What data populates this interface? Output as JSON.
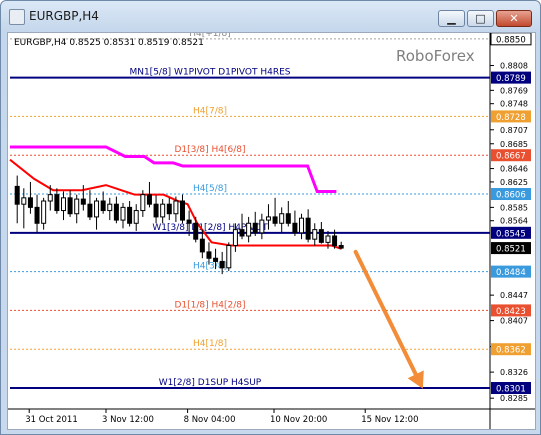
{
  "window": {
    "title": "EURGBP,H4",
    "min_glyph": "▁",
    "max_glyph": "□",
    "close_glyph": "✕"
  },
  "chart_data": {
    "type": "candlestick",
    "symbol_info": "EURGBP,H4  0.8525 0.8531 0.8519 0.8521",
    "watermark": "RoboForex",
    "ylim": [
      0.8268,
      0.8856
    ],
    "price_labels": [
      "0.8850",
      "0.8789",
      "0.8728",
      "0.8667",
      "0.8606",
      "0.8545",
      "0.8484",
      "0.8423",
      "0.8362",
      "0.8301"
    ],
    "tick_labels": [
      "0.8850",
      "0.8789",
      "0.8728",
      "0.8667",
      "0.8606",
      "0.8545",
      "0.8521",
      "0.8484",
      "0.8423",
      "0.8362",
      "0.8301",
      "0.8285",
      "0.8326",
      "0.8366",
      "0.8407",
      "0.8447",
      "0.8564",
      "0.8585",
      "0.8625",
      "0.8646",
      "0.8685",
      "0.8707",
      "0.8748",
      "0.8769",
      "0.8808"
    ],
    "x_labels": [
      "31 Oct 2011",
      "3 Nov 12:00",
      "8 Nov 04:00",
      "10 Nov 20:00",
      "15 Nov 12:00"
    ],
    "x_domain": [
      0,
      100
    ],
    "x_label_positions": [
      4,
      20,
      37,
      55,
      74
    ],
    "current_price": "0.8521",
    "levels": [
      {
        "price": 0.885,
        "label": "H4[+1/8]",
        "color": "#a0a0a0",
        "style": "dash",
        "tag_bg": "#ffffff",
        "tag_fg": "#000000",
        "tag": "0.8850"
      },
      {
        "price": 0.8789,
        "label": "MN1[5/8]  W1PIVOT  D1PIVOT  H4RES",
        "color": "#00007f",
        "style": "solid",
        "tag_bg": "#00007f",
        "tag_fg": "#ffffff",
        "tag": "0.8789",
        "label_color": "#00007f"
      },
      {
        "price": 0.8728,
        "label": "H4[7/8]",
        "color": "#f0a030",
        "style": "dash",
        "tag_bg": "#f0a030",
        "tag_fg": "#ffffff",
        "tag": "0.8728",
        "label_color": "#f0a030"
      },
      {
        "price": 0.8667,
        "label": "D1[3/8]  H4[6/8]",
        "color": "#e85030",
        "style": "dash",
        "tag_bg": "#e85030",
        "tag_fg": "#ffffff",
        "tag": "0.8667",
        "label_color": "#e85030"
      },
      {
        "price": 0.8606,
        "label": "H4[5/8]",
        "color": "#3a9ade",
        "style": "dash",
        "tag_bg": "#3a9ade",
        "tag_fg": "#ffffff",
        "tag": "0.8606",
        "label_color": "#3a9ade"
      },
      {
        "price": 0.8545,
        "label": "W1[3/8]  D1[2/8]  H4PIVOT",
        "color": "#00007f",
        "style": "solid",
        "tag_bg": "#00007f",
        "tag_fg": "#ffffff",
        "tag": "0.8545",
        "label_color": "#00007f"
      },
      {
        "price": 0.8484,
        "label": "H4[3/8]",
        "color": "#3a9ade",
        "style": "dash",
        "tag_bg": "#3a9ade",
        "tag_fg": "#ffffff",
        "tag": "0.8484",
        "label_color": "#3a9ade"
      },
      {
        "price": 0.8423,
        "label": "D1[1/8]  H4[2/8]",
        "color": "#e85030",
        "style": "dash",
        "tag_bg": "#e85030",
        "tag_fg": "#ffffff",
        "tag": "0.8423",
        "label_color": "#e85030"
      },
      {
        "price": 0.8362,
        "label": "H4[1/8]",
        "color": "#f0a030",
        "style": "dash",
        "tag_bg": "#f0a030",
        "tag_fg": "#ffffff",
        "tag": "0.8362",
        "label_color": "#f0a030"
      },
      {
        "price": 0.8301,
        "label": "W1[2/8]  D1SUP  H4SUP",
        "color": "#00007f",
        "style": "solid",
        "tag_bg": "#00007f",
        "tag_fg": "#ffffff",
        "tag": "0.8301",
        "label_color": "#00007f"
      }
    ],
    "candles": [
      [
        0.8618,
        0.8635,
        0.856,
        0.859
      ],
      [
        0.859,
        0.8615,
        0.8552,
        0.86
      ],
      [
        0.86,
        0.8625,
        0.8575,
        0.8585
      ],
      [
        0.8585,
        0.8605,
        0.8545,
        0.856
      ],
      [
        0.856,
        0.86,
        0.855,
        0.8595
      ],
      [
        0.8595,
        0.862,
        0.858,
        0.8605
      ],
      [
        0.8605,
        0.8615,
        0.8575,
        0.858
      ],
      [
        0.858,
        0.861,
        0.8565,
        0.86
      ],
      [
        0.86,
        0.8612,
        0.857,
        0.8575
      ],
      [
        0.8575,
        0.8605,
        0.856,
        0.8598
      ],
      [
        0.8598,
        0.862,
        0.858,
        0.859
      ],
      [
        0.859,
        0.8612,
        0.8565,
        0.857
      ],
      [
        0.857,
        0.86,
        0.855,
        0.8595
      ],
      [
        0.8595,
        0.861,
        0.8575,
        0.858
      ],
      [
        0.858,
        0.86,
        0.8565,
        0.859
      ],
      [
        0.859,
        0.8602,
        0.856,
        0.8565
      ],
      [
        0.8565,
        0.8592,
        0.8552,
        0.8585
      ],
      [
        0.8585,
        0.8595,
        0.8555,
        0.856
      ],
      [
        0.856,
        0.859,
        0.8548,
        0.858
      ],
      [
        0.858,
        0.8612,
        0.857,
        0.8605
      ],
      [
        0.8605,
        0.8625,
        0.8585,
        0.859
      ],
      [
        0.859,
        0.8604,
        0.856,
        0.857
      ],
      [
        0.857,
        0.8598,
        0.856,
        0.859
      ],
      [
        0.859,
        0.86,
        0.8565,
        0.8575
      ],
      [
        0.8575,
        0.8602,
        0.8562,
        0.8595
      ],
      [
        0.8595,
        0.8605,
        0.856,
        0.8565
      ],
      [
        0.8565,
        0.858,
        0.854,
        0.856
      ],
      [
        0.856,
        0.857,
        0.853,
        0.8535
      ],
      [
        0.8535,
        0.855,
        0.8505,
        0.8515
      ],
      [
        0.8515,
        0.853,
        0.8495,
        0.8505
      ],
      [
        0.8505,
        0.852,
        0.8488,
        0.85
      ],
      [
        0.85,
        0.8515,
        0.848,
        0.849
      ],
      [
        0.849,
        0.853,
        0.8485,
        0.8525
      ],
      [
        0.8525,
        0.856,
        0.8515,
        0.855
      ],
      [
        0.855,
        0.8575,
        0.8535,
        0.854
      ],
      [
        0.854,
        0.857,
        0.853,
        0.856
      ],
      [
        0.856,
        0.8578,
        0.854,
        0.8545
      ],
      [
        0.8545,
        0.8575,
        0.8535,
        0.8565
      ],
      [
        0.8565,
        0.859,
        0.855,
        0.857
      ],
      [
        0.857,
        0.86,
        0.8555,
        0.856
      ],
      [
        0.856,
        0.8585,
        0.8545,
        0.8575
      ],
      [
        0.8575,
        0.8595,
        0.8555,
        0.856
      ],
      [
        0.856,
        0.858,
        0.854,
        0.8545
      ],
      [
        0.8545,
        0.8575,
        0.8535,
        0.8568
      ],
      [
        0.8568,
        0.8582,
        0.853,
        0.8535
      ],
      [
        0.8535,
        0.856,
        0.8525,
        0.855
      ],
      [
        0.855,
        0.8562,
        0.8528,
        0.853
      ],
      [
        0.853,
        0.8548,
        0.852,
        0.854
      ],
      [
        0.854,
        0.855,
        0.852,
        0.8525
      ],
      [
        0.8525,
        0.8531,
        0.8519,
        0.8521
      ]
    ],
    "red_line": [
      [
        0,
        0.866
      ],
      [
        5,
        0.863
      ],
      [
        9,
        0.8612
      ],
      [
        15,
        0.8612
      ],
      [
        20,
        0.862
      ],
      [
        26,
        0.8605
      ],
      [
        32,
        0.8605
      ],
      [
        35,
        0.8595
      ],
      [
        37,
        0.859
      ],
      [
        39,
        0.856
      ],
      [
        42,
        0.853
      ],
      [
        46,
        0.8525
      ],
      [
        50,
        0.8525
      ],
      [
        56,
        0.8525
      ],
      [
        62,
        0.8525
      ],
      [
        67,
        0.8525
      ],
      [
        69,
        0.852
      ]
    ],
    "magenta_line": [
      [
        0,
        0.868
      ],
      [
        20,
        0.868
      ],
      [
        24,
        0.8665
      ],
      [
        28,
        0.8665
      ],
      [
        30,
        0.8655
      ],
      [
        34,
        0.8655
      ],
      [
        36,
        0.865
      ],
      [
        62,
        0.865
      ],
      [
        64,
        0.861
      ],
      [
        68,
        0.861
      ]
    ],
    "arrow": {
      "from": [
        72,
        0.8515
      ],
      "to": [
        86,
        0.83
      ],
      "color": "#f28c38"
    }
  }
}
